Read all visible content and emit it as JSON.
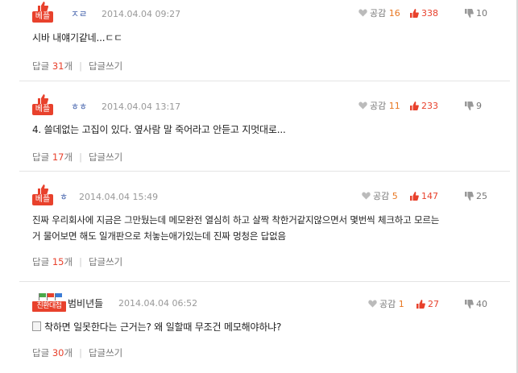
{
  "labels": {
    "best": "베플",
    "cleanbot": "친환대첩",
    "like_label": "공감",
    "reply_label": "답글",
    "reply_unit": "개",
    "write_reply": "답글쓰기"
  },
  "comments": [
    {
      "nickname": "ㅈㄹ",
      "date": "2014.04.04 09:27",
      "body": "시바 내얘기같네...ㄷㄷ",
      "like_count": "16",
      "up_count": "338",
      "down_count": "10",
      "reply_count": "31"
    },
    {
      "nickname": "ㅎㅎ",
      "date": "2014.04.04 13:17",
      "body": "4. 쓸데없는 고집이 있다. 옆사람 말 죽어라고 안듣고 지멋대로...",
      "like_count": "11",
      "up_count": "233",
      "down_count": "9",
      "reply_count": "17"
    },
    {
      "nickname": "ㅎ",
      "date": "2014.04.04 15:49",
      "body_line1": "진짜 우리회사에 지금은 그만뒀는데 메모완전 열심히 하고 살짝 착한거같지않으면서 몇번씩 체크하고 모르는",
      "body_line2": "거 물어보면 해도 일개판으로 처놓는애가있는데 진짜 멍청은 답없음",
      "like_count": "5",
      "up_count": "147",
      "down_count": "25",
      "reply_count": "15"
    },
    {
      "nickname": "범비년들",
      "date": "2014.04.04 06:52",
      "body": "착하면 일못한다는 근거는? 왜 일할때 무조건 메모해야하냐?",
      "like_count": "1",
      "up_count": "27",
      "down_count": "40",
      "reply_count": "30"
    }
  ],
  "colors": {
    "accent_red": "#e8412c",
    "flag_green": "#4aa84a",
    "flag_blue": "#3a7bd5",
    "flag_red": "#e8412c",
    "nickname_blue": "#3a5aa8"
  },
  "icons": {
    "best": "thumbs-up-icon",
    "like": "heart-icon",
    "up": "thumbs-up-icon",
    "down": "thumbs-down-icon",
    "attachment": "memo-icon"
  }
}
